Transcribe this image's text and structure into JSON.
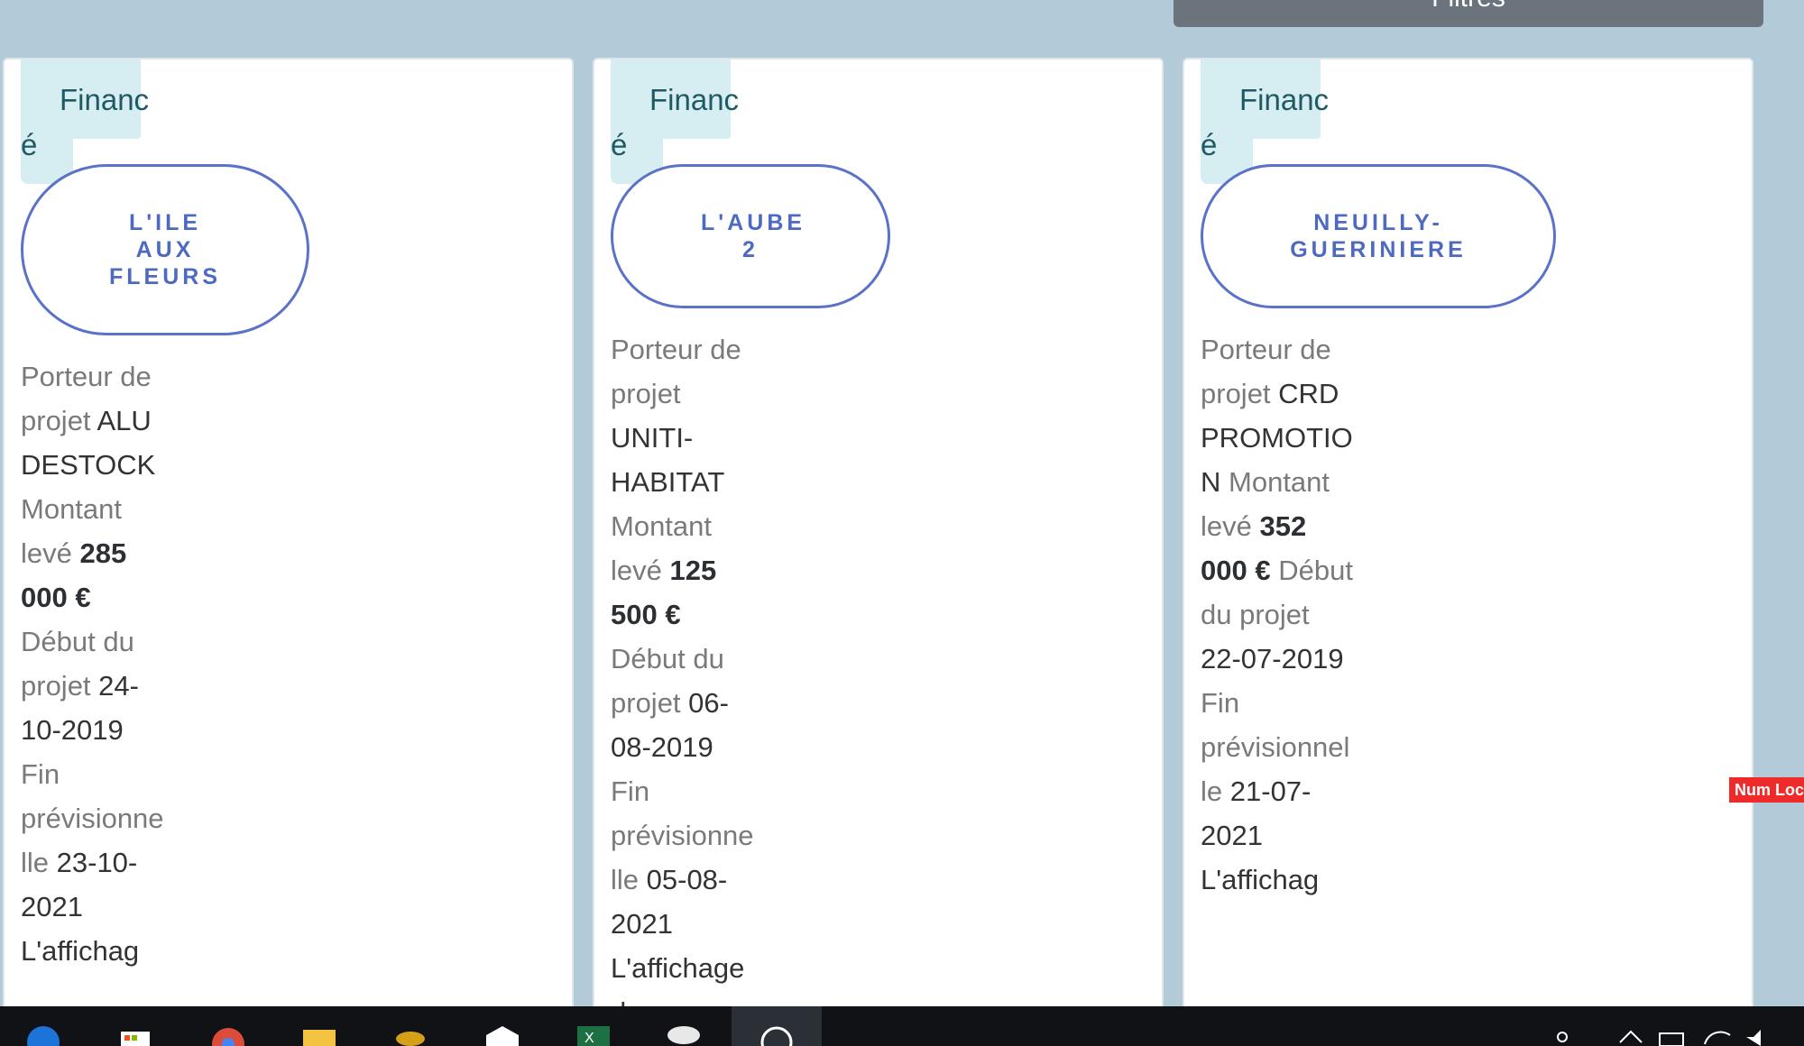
{
  "topbar": {
    "filters_label": "Filtres"
  },
  "cards": [
    {
      "badge_line1": "Financ",
      "badge_line2": "é",
      "name": "L'ILE AUX FLEURS",
      "porteur_label": "Porteur de projet",
      "porteur_value": "ALU DESTOCK",
      "montant_label": "Montant levé",
      "montant_value": "285 000 €",
      "debut_label": "Début du projet",
      "debut_value": "24-10-2019",
      "fin_label": "Fin prévisionnelle",
      "fin_value": "23-10-2021",
      "affichage_label": "L'affichag"
    },
    {
      "badge_line1": "Financ",
      "badge_line2": "é",
      "name": "L'AUBE 2",
      "porteur_label": "Porteur de projet",
      "porteur_value": "UNITI-HABITAT",
      "montant_label": "Montant levé",
      "montant_value": "125 500 €",
      "debut_label": "Début du projet",
      "debut_value": "06-08-2019",
      "fin_label": "Fin prévisionnelle",
      "fin_value": "05-08-2021",
      "affichage_label": "L'affichage du"
    },
    {
      "badge_line1": "Financ",
      "badge_line2": "é",
      "name": "NEUILLY-GUERINIERE",
      "porteur_label": "Porteur de projet",
      "porteur_value": "CRD PROMOTION",
      "montant_label": "Montant levé",
      "montant_value": "352 000 €",
      "debut_label": "Début du projet",
      "debut_value": "22-07-2019",
      "fin_label": "Fin prévisionnelle",
      "fin_value": "21-07-2021",
      "affichage_label": "L'affichag"
    }
  ],
  "overlay": {
    "numlock": "Num Lock"
  },
  "taskbar": {
    "icons": [
      "edge-icon",
      "store-icon",
      "chrome-icon",
      "file-explorer-icon",
      "coins-app-icon",
      "mail-icon",
      "excel-icon",
      "satellite-app-icon",
      "active-app-icon"
    ],
    "tray_icons": [
      "people-icon",
      "chevron-up-icon",
      "battery-icon",
      "wifi-icon",
      "volume-icon"
    ]
  },
  "colors": {
    "accent": "#5a72c7",
    "badge_bg": "#d6eef1",
    "page_bg": "#b3cbd8",
    "numlock_bg": "#ef2a2a"
  }
}
